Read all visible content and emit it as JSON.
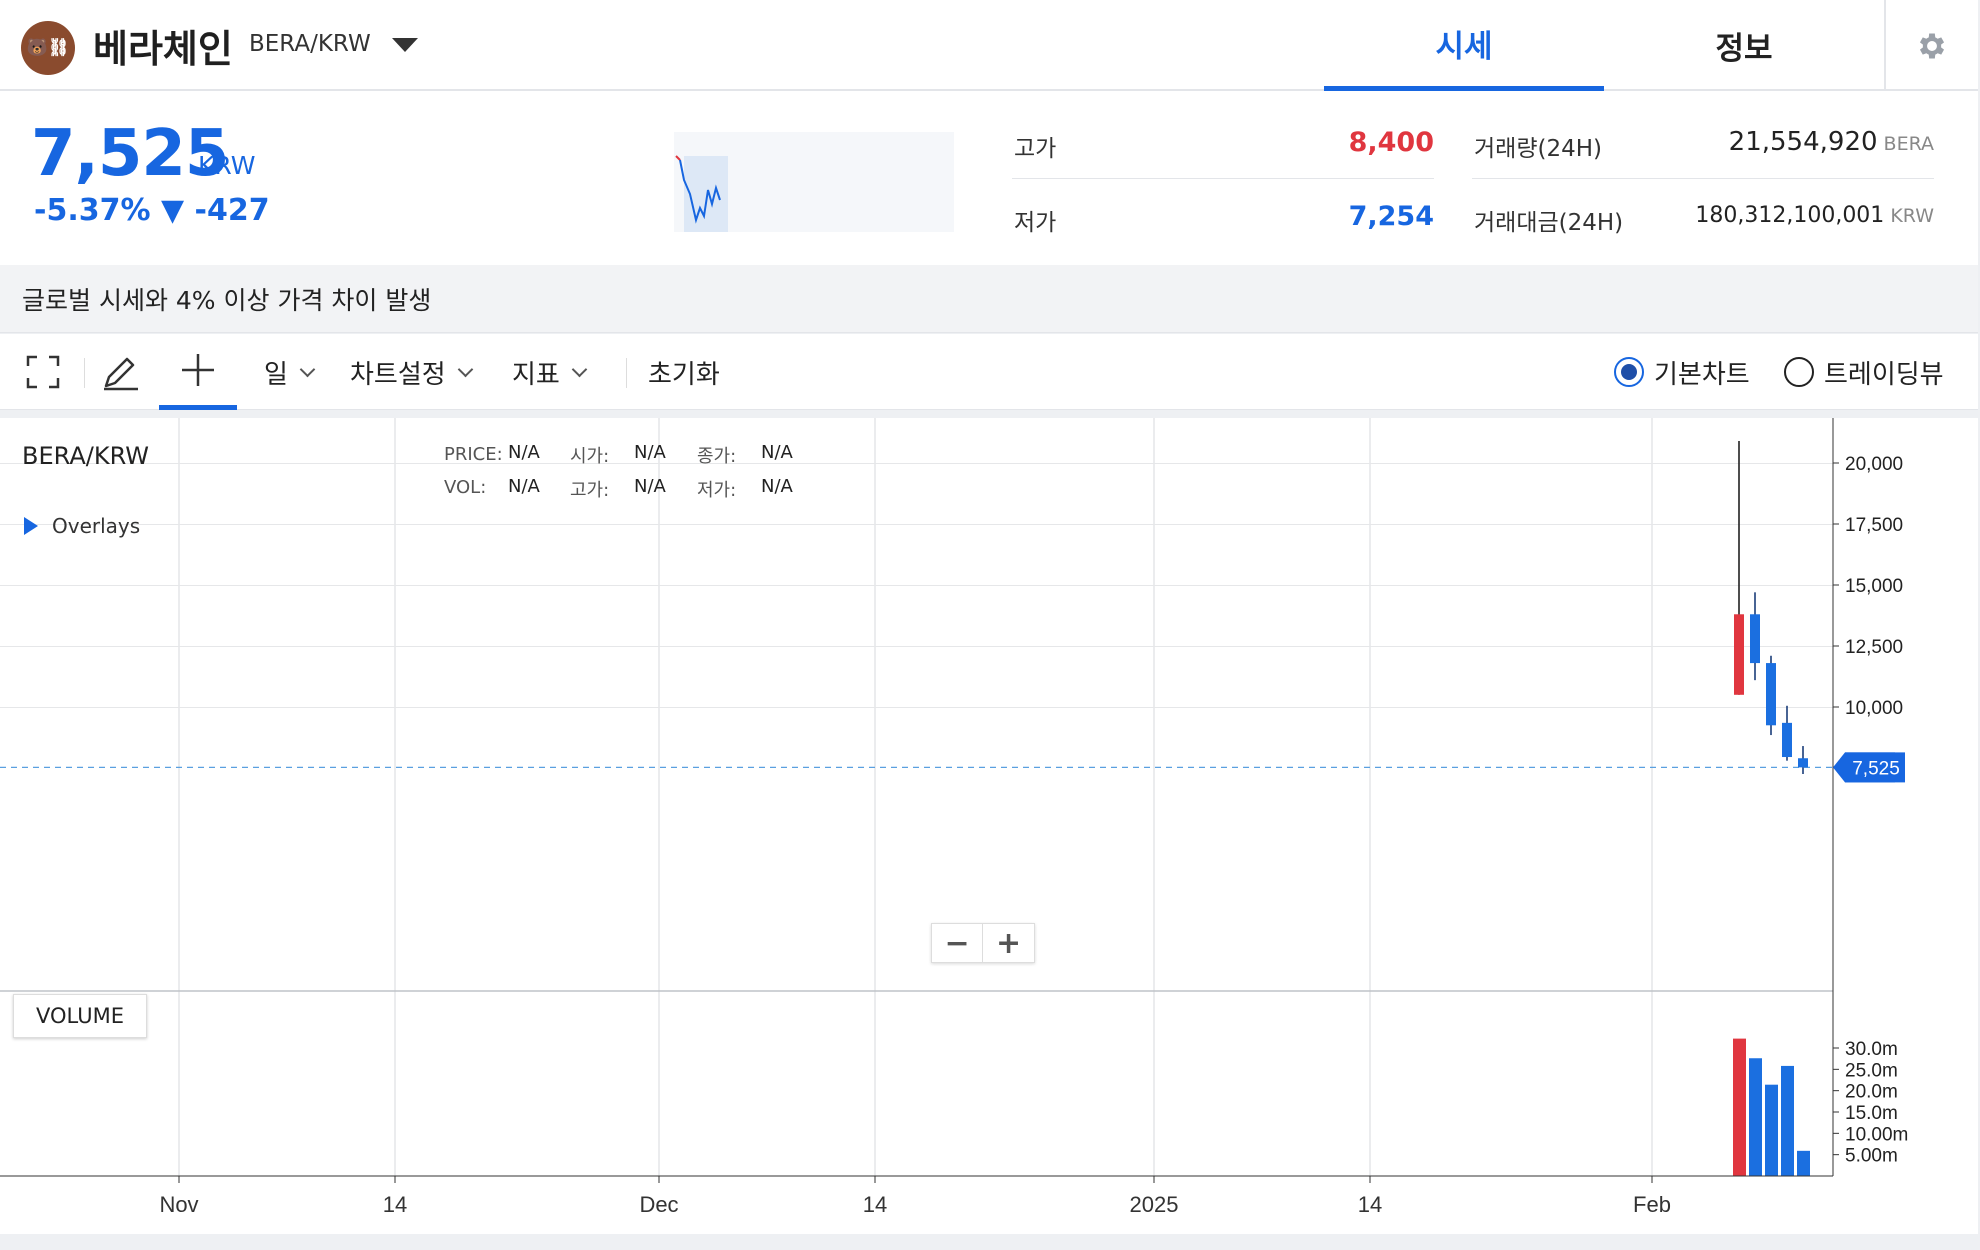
{
  "header": {
    "logo_text": "🐻⛓",
    "coin_name": "베라체인",
    "pair": "BERA/KRW",
    "tabs": [
      {
        "label": "시세"
      },
      {
        "label": "정보"
      }
    ]
  },
  "summary": {
    "price": "7,525",
    "price_unit": "KRW",
    "change": "-5.37% ▼ -427",
    "stats": {
      "high_label": "고가",
      "high_value": "8,400",
      "low_label": "저가",
      "low_value": "7,254",
      "volume_label": "거래량(24H)",
      "volume_value": "21,554,920",
      "volume_unit": "BERA",
      "amount_label": "거래대금(24H)",
      "amount_value": "180,312,100,001",
      "amount_unit": "KRW"
    }
  },
  "notice": "글로벌 시세와 4% 이상 가격 차이 발생",
  "toolbar": {
    "period": "일",
    "chart_settings": "차트설정",
    "indicators": "지표",
    "reset": "초기화",
    "basic_chart": "기본차트",
    "tradingview": "트레이딩뷰"
  },
  "chart": {
    "pair": "BERA/KRW",
    "overlays": "Overlays",
    "info": {
      "price_label": "PRICE:",
      "price": "N/A",
      "open_label": "시가:",
      "open": "N/A",
      "close_label": "종가:",
      "close": "N/A",
      "vol_label": "VOL:",
      "vol": "N/A",
      "high_label": "고가:",
      "high": "N/A",
      "low_label": "저가:",
      "low": "N/A"
    },
    "volume_label": "VOLUME",
    "zoom_out": "−",
    "zoom_in": "+",
    "current_price_tag": "7,525"
  },
  "chart_data": {
    "type": "candlestick",
    "x_ticks": [
      "Nov",
      "14",
      "Dec",
      "14",
      "2025",
      "14",
      "Feb"
    ],
    "y_ticks": [
      "20,000",
      "17,500",
      "15,000",
      "12,500",
      "10,000"
    ],
    "volume_ticks": [
      "30.0m",
      "25.0m",
      "20.0m",
      "15.0m",
      "10.00m",
      "5.00m"
    ],
    "current_price": 7525,
    "candles": [
      {
        "open": 10500,
        "high": 20900,
        "low": 10500,
        "close": 13800,
        "color": "red"
      },
      {
        "open": 13800,
        "high": 14700,
        "low": 11100,
        "close": 11800,
        "color": "blue"
      },
      {
        "open": 11800,
        "high": 12100,
        "low": 8850,
        "close": 9250,
        "color": "blue"
      },
      {
        "open": 9350,
        "high": 10050,
        "low": 7800,
        "close": 7950,
        "color": "blue"
      },
      {
        "open": 7900,
        "high": 8400,
        "low": 7254,
        "close": 7525,
        "color": "blue"
      }
    ],
    "volumes_m": [
      32.2,
      27.6,
      21.4,
      25.8,
      5.9
    ],
    "colors": {
      "up": "#e0363f",
      "down": "#1b6fe0",
      "accent": "#1766e0"
    }
  }
}
